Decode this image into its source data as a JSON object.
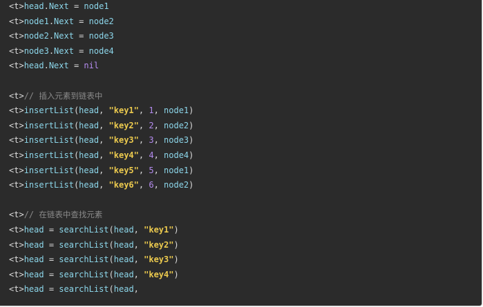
{
  "code_lines": [
    {
      "tag": "<t>",
      "parts": [
        {
          "t": "head",
          "c": "id"
        },
        {
          "t": ".",
          "c": "plain"
        },
        {
          "t": "Next",
          "c": "id"
        },
        {
          "t": " = ",
          "c": "plain"
        },
        {
          "t": "node1",
          "c": "id"
        }
      ]
    },
    {
      "tag": "<t>",
      "parts": [
        {
          "t": "node1",
          "c": "id"
        },
        {
          "t": ".",
          "c": "plain"
        },
        {
          "t": "Next",
          "c": "id"
        },
        {
          "t": " = ",
          "c": "plain"
        },
        {
          "t": "node2",
          "c": "id"
        }
      ]
    },
    {
      "tag": "<t>",
      "parts": [
        {
          "t": "node2",
          "c": "id"
        },
        {
          "t": ".",
          "c": "plain"
        },
        {
          "t": "Next",
          "c": "id"
        },
        {
          "t": " = ",
          "c": "plain"
        },
        {
          "t": "node3",
          "c": "id"
        }
      ]
    },
    {
      "tag": "<t>",
      "parts": [
        {
          "t": "node3",
          "c": "id"
        },
        {
          "t": ".",
          "c": "plain"
        },
        {
          "t": "Next",
          "c": "id"
        },
        {
          "t": " = ",
          "c": "plain"
        },
        {
          "t": "node4",
          "c": "id"
        }
      ]
    },
    {
      "tag": "<t>",
      "parts": [
        {
          "t": "head",
          "c": "id"
        },
        {
          "t": ".",
          "c": "plain"
        },
        {
          "t": "Next",
          "c": "id"
        },
        {
          "t": " = ",
          "c": "plain"
        },
        {
          "t": "nil",
          "c": "kw"
        }
      ]
    },
    {
      "tag": "",
      "parts": []
    },
    {
      "tag": "<t>",
      "parts": [
        {
          "t": "// ",
          "c": "comment"
        },
        {
          "t": "插入元素到链表中",
          "c": "comment cjk"
        }
      ]
    },
    {
      "tag": "<t>",
      "parts": [
        {
          "t": "insertList",
          "c": "id"
        },
        {
          "t": "(",
          "c": "plain"
        },
        {
          "t": "head",
          "c": "id"
        },
        {
          "t": ", ",
          "c": "plain"
        },
        {
          "t": "\"key1\"",
          "c": "str"
        },
        {
          "t": ", ",
          "c": "plain"
        },
        {
          "t": "1",
          "c": "num"
        },
        {
          "t": ", ",
          "c": "plain"
        },
        {
          "t": "node1",
          "c": "id"
        },
        {
          "t": ")",
          "c": "plain"
        }
      ]
    },
    {
      "tag": "<t>",
      "parts": [
        {
          "t": "insertList",
          "c": "id"
        },
        {
          "t": "(",
          "c": "plain"
        },
        {
          "t": "head",
          "c": "id"
        },
        {
          "t": ", ",
          "c": "plain"
        },
        {
          "t": "\"key2\"",
          "c": "str"
        },
        {
          "t": ", ",
          "c": "plain"
        },
        {
          "t": "2",
          "c": "num"
        },
        {
          "t": ", ",
          "c": "plain"
        },
        {
          "t": "node2",
          "c": "id"
        },
        {
          "t": ")",
          "c": "plain"
        }
      ]
    },
    {
      "tag": "<t>",
      "parts": [
        {
          "t": "insertList",
          "c": "id"
        },
        {
          "t": "(",
          "c": "plain"
        },
        {
          "t": "head",
          "c": "id"
        },
        {
          "t": ", ",
          "c": "plain"
        },
        {
          "t": "\"key3\"",
          "c": "str"
        },
        {
          "t": ", ",
          "c": "plain"
        },
        {
          "t": "3",
          "c": "num"
        },
        {
          "t": ", ",
          "c": "plain"
        },
        {
          "t": "node3",
          "c": "id"
        },
        {
          "t": ")",
          "c": "plain"
        }
      ]
    },
    {
      "tag": "<t>",
      "parts": [
        {
          "t": "insertList",
          "c": "id"
        },
        {
          "t": "(",
          "c": "plain"
        },
        {
          "t": "head",
          "c": "id"
        },
        {
          "t": ", ",
          "c": "plain"
        },
        {
          "t": "\"key4\"",
          "c": "str"
        },
        {
          "t": ", ",
          "c": "plain"
        },
        {
          "t": "4",
          "c": "num"
        },
        {
          "t": ", ",
          "c": "plain"
        },
        {
          "t": "node4",
          "c": "id"
        },
        {
          "t": ")",
          "c": "plain"
        }
      ]
    },
    {
      "tag": "<t>",
      "parts": [
        {
          "t": "insertList",
          "c": "id"
        },
        {
          "t": "(",
          "c": "plain"
        },
        {
          "t": "head",
          "c": "id"
        },
        {
          "t": ", ",
          "c": "plain"
        },
        {
          "t": "\"key5\"",
          "c": "str"
        },
        {
          "t": ", ",
          "c": "plain"
        },
        {
          "t": "5",
          "c": "num"
        },
        {
          "t": ", ",
          "c": "plain"
        },
        {
          "t": "node1",
          "c": "id"
        },
        {
          "t": ")",
          "c": "plain"
        }
      ]
    },
    {
      "tag": "<t>",
      "parts": [
        {
          "t": "insertList",
          "c": "id"
        },
        {
          "t": "(",
          "c": "plain"
        },
        {
          "t": "head",
          "c": "id"
        },
        {
          "t": ", ",
          "c": "plain"
        },
        {
          "t": "\"key6\"",
          "c": "str"
        },
        {
          "t": ", ",
          "c": "plain"
        },
        {
          "t": "6",
          "c": "num"
        },
        {
          "t": ", ",
          "c": "plain"
        },
        {
          "t": "node2",
          "c": "id"
        },
        {
          "t": ")",
          "c": "plain"
        }
      ]
    },
    {
      "tag": "",
      "parts": []
    },
    {
      "tag": "<t>",
      "parts": [
        {
          "t": "// ",
          "c": "comment"
        },
        {
          "t": "在链表中查找元素",
          "c": "comment cjk"
        }
      ]
    },
    {
      "tag": "<t>",
      "parts": [
        {
          "t": "head",
          "c": "id"
        },
        {
          "t": " = ",
          "c": "plain"
        },
        {
          "t": "searchList",
          "c": "id"
        },
        {
          "t": "(",
          "c": "plain"
        },
        {
          "t": "head",
          "c": "id"
        },
        {
          "t": ", ",
          "c": "plain"
        },
        {
          "t": "\"key1\"",
          "c": "str"
        },
        {
          "t": ")",
          "c": "plain"
        }
      ]
    },
    {
      "tag": "<t>",
      "parts": [
        {
          "t": "head",
          "c": "id"
        },
        {
          "t": " = ",
          "c": "plain"
        },
        {
          "t": "searchList",
          "c": "id"
        },
        {
          "t": "(",
          "c": "plain"
        },
        {
          "t": "head",
          "c": "id"
        },
        {
          "t": ", ",
          "c": "plain"
        },
        {
          "t": "\"key2\"",
          "c": "str"
        },
        {
          "t": ")",
          "c": "plain"
        }
      ]
    },
    {
      "tag": "<t>",
      "parts": [
        {
          "t": "head",
          "c": "id"
        },
        {
          "t": " = ",
          "c": "plain"
        },
        {
          "t": "searchList",
          "c": "id"
        },
        {
          "t": "(",
          "c": "plain"
        },
        {
          "t": "head",
          "c": "id"
        },
        {
          "t": ", ",
          "c": "plain"
        },
        {
          "t": "\"key3\"",
          "c": "str"
        },
        {
          "t": ")",
          "c": "plain"
        }
      ]
    },
    {
      "tag": "<t>",
      "parts": [
        {
          "t": "head",
          "c": "id"
        },
        {
          "t": " = ",
          "c": "plain"
        },
        {
          "t": "searchList",
          "c": "id"
        },
        {
          "t": "(",
          "c": "plain"
        },
        {
          "t": "head",
          "c": "id"
        },
        {
          "t": ", ",
          "c": "plain"
        },
        {
          "t": "\"key4\"",
          "c": "str"
        },
        {
          "t": ")",
          "c": "plain"
        }
      ]
    },
    {
      "tag": "<t>",
      "parts": [
        {
          "t": "head",
          "c": "id"
        },
        {
          "t": " = ",
          "c": "plain"
        },
        {
          "t": "searchList",
          "c": "id"
        },
        {
          "t": "(",
          "c": "plain"
        },
        {
          "t": "head",
          "c": "id"
        },
        {
          "t": ",",
          "c": "plain"
        }
      ]
    }
  ],
  "colors": {
    "background": "#2b2b2b",
    "identifier": "#8cd6ea",
    "string": "#ecca4e",
    "number_keyword": "#b58cf0",
    "comment": "#8a8a8a",
    "plain": "#dcdcdc"
  }
}
